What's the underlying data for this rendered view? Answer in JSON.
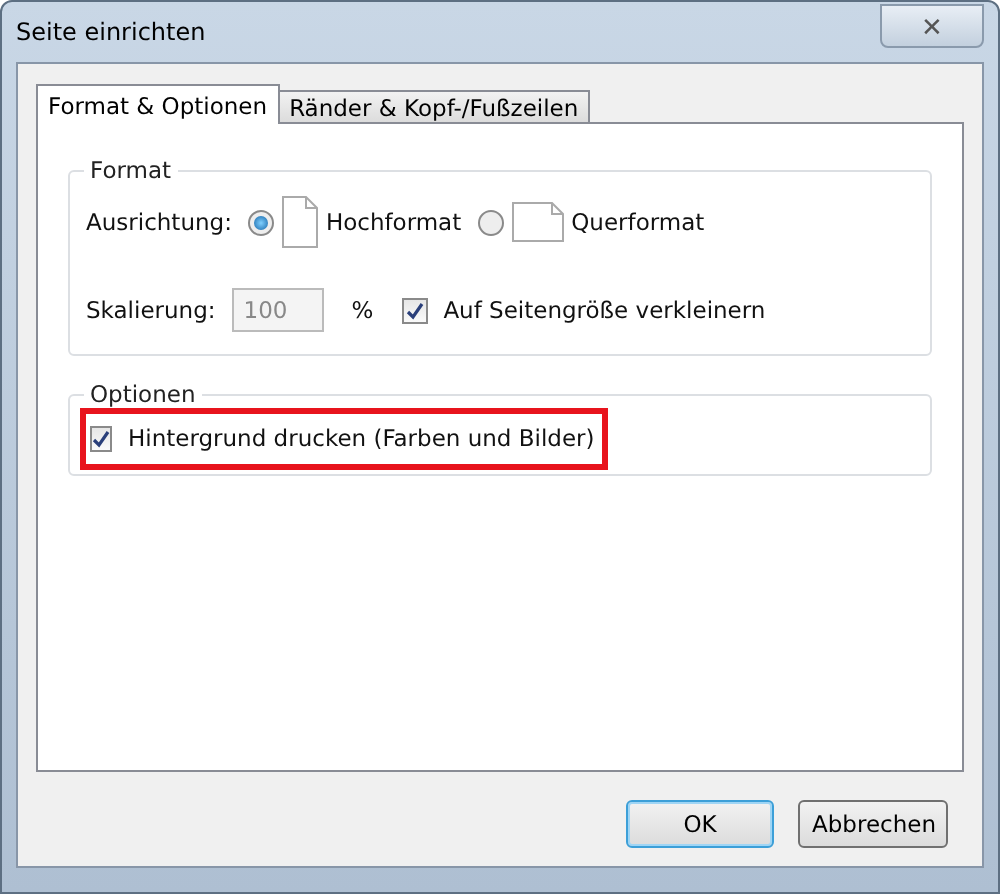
{
  "window": {
    "title": "Seite einrichten",
    "close": "✕"
  },
  "tabs": [
    {
      "label": "Format & Optionen",
      "selected": true
    },
    {
      "label": "Ränder & Kopf-/Fußzeilen",
      "selected": false
    }
  ],
  "format_group": {
    "title": "Format",
    "orientation_label": "Ausrichtung:",
    "orientations": [
      {
        "label": "Hochformat",
        "kind": "portrait",
        "selected": true
      },
      {
        "label": "Querformat",
        "kind": "landscape",
        "selected": false
      }
    ],
    "scale_label": "Skalierung:",
    "scale_value": "100",
    "scale_disabled": true,
    "scale_unit": "%",
    "shrink": {
      "label": "Auf Seitengröße verkleinern",
      "checked": true
    }
  },
  "options_group": {
    "title": "Optionen",
    "items": [
      {
        "label": "Hintergrund drucken (Farben und Bilder)",
        "checked": true,
        "highlighted": true
      }
    ]
  },
  "buttons": [
    {
      "label": "OK",
      "default": true
    },
    {
      "label": "Abbrechen",
      "default": false
    }
  ]
}
